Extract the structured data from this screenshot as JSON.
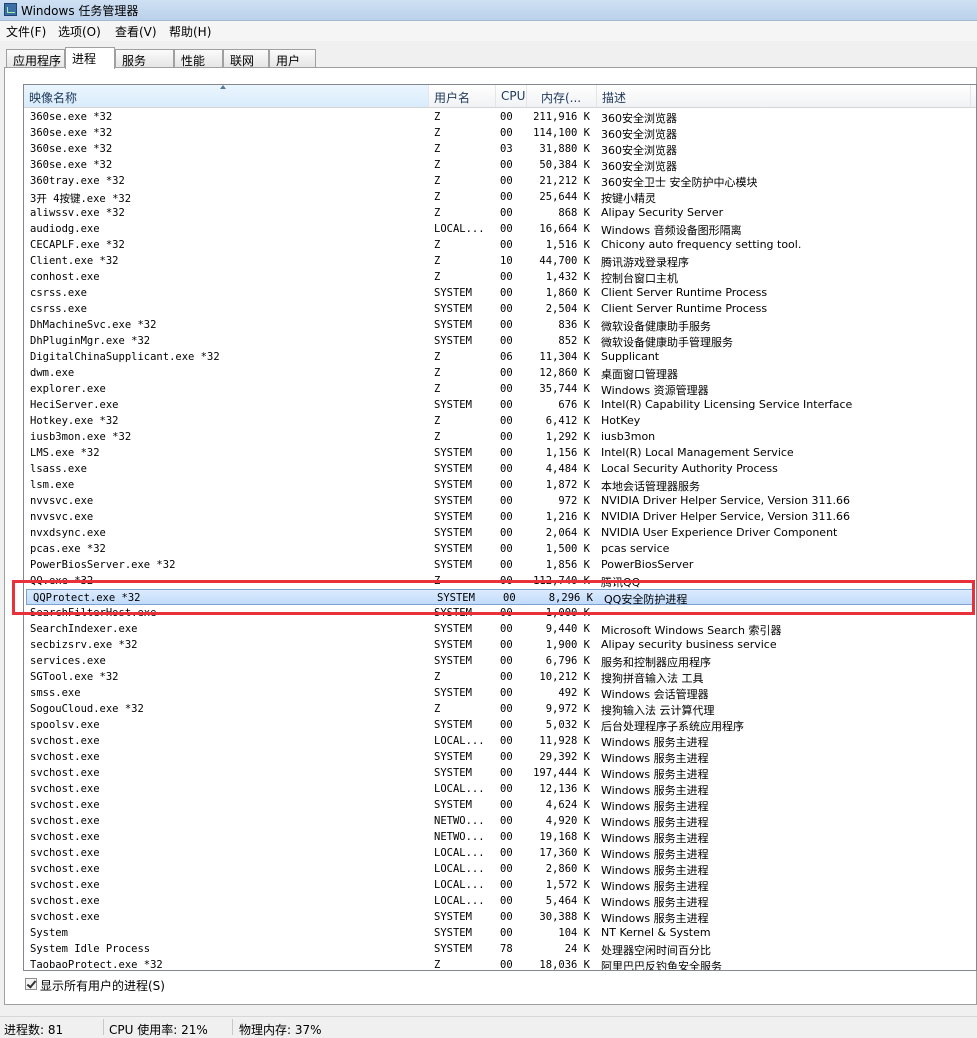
{
  "window": {
    "title": "Windows 任务管理器"
  },
  "menu": [
    "文件(F)",
    "选项(O)",
    "查看(V)",
    "帮助(H)"
  ],
  "tabs": [
    "应用程序",
    "进程",
    "服务",
    "性能",
    "联网",
    "用户"
  ],
  "active_tab": "进程",
  "columns": {
    "name": "映像名称",
    "user": "用户名",
    "cpu": "CPU",
    "mem": "内存(...",
    "desc": "描述"
  },
  "processes": [
    {
      "name": "360se.exe *32",
      "user": "Z",
      "cpu": "00",
      "mem": "211,916 K",
      "desc": "360安全浏览器"
    },
    {
      "name": "360se.exe *32",
      "user": "Z",
      "cpu": "00",
      "mem": "114,100 K",
      "desc": "360安全浏览器"
    },
    {
      "name": "360se.exe *32",
      "user": "Z",
      "cpu": "03",
      "mem": "31,880 K",
      "desc": "360安全浏览器"
    },
    {
      "name": "360se.exe *32",
      "user": "Z",
      "cpu": "00",
      "mem": "50,384 K",
      "desc": "360安全浏览器"
    },
    {
      "name": "360tray.exe *32",
      "user": "Z",
      "cpu": "00",
      "mem": "21,212 K",
      "desc": "360安全卫士 安全防护中心模块"
    },
    {
      "name": "3开 4按键.exe *32",
      "user": "Z",
      "cpu": "00",
      "mem": "25,644 K",
      "desc": "按键小精灵"
    },
    {
      "name": "aliwssv.exe *32",
      "user": "Z",
      "cpu": "00",
      "mem": "868 K",
      "desc": "Alipay Security Server"
    },
    {
      "name": "audiodg.exe",
      "user": "LOCAL...",
      "cpu": "00",
      "mem": "16,664 K",
      "desc": "Windows 音频设备图形隔离"
    },
    {
      "name": "CECAPLF.exe *32",
      "user": "Z",
      "cpu": "00",
      "mem": "1,516 K",
      "desc": "Chicony auto frequency setting tool."
    },
    {
      "name": "Client.exe *32",
      "user": "Z",
      "cpu": "10",
      "mem": "44,700 K",
      "desc": "腾讯游戏登录程序"
    },
    {
      "name": "conhost.exe",
      "user": "Z",
      "cpu": "00",
      "mem": "1,432 K",
      "desc": "控制台窗口主机"
    },
    {
      "name": "csrss.exe",
      "user": "SYSTEM",
      "cpu": "00",
      "mem": "1,860 K",
      "desc": "Client Server Runtime Process"
    },
    {
      "name": "csrss.exe",
      "user": "SYSTEM",
      "cpu": "00",
      "mem": "2,504 K",
      "desc": "Client Server Runtime Process"
    },
    {
      "name": "DhMachineSvc.exe *32",
      "user": "SYSTEM",
      "cpu": "00",
      "mem": "836 K",
      "desc": "微软设备健康助手服务"
    },
    {
      "name": "DhPluginMgr.exe *32",
      "user": "SYSTEM",
      "cpu": "00",
      "mem": "852 K",
      "desc": "微软设备健康助手管理服务"
    },
    {
      "name": "DigitalChinaSupplicant.exe *32",
      "user": "Z",
      "cpu": "06",
      "mem": "11,304 K",
      "desc": "Supplicant"
    },
    {
      "name": "dwm.exe",
      "user": "Z",
      "cpu": "00",
      "mem": "12,860 K",
      "desc": "桌面窗口管理器"
    },
    {
      "name": "explorer.exe",
      "user": "Z",
      "cpu": "00",
      "mem": "35,744 K",
      "desc": "Windows 资源管理器"
    },
    {
      "name": "HeciServer.exe",
      "user": "SYSTEM",
      "cpu": "00",
      "mem": "676 K",
      "desc": "Intel(R) Capability Licensing Service Interface"
    },
    {
      "name": "Hotkey.exe *32",
      "user": "Z",
      "cpu": "00",
      "mem": "6,412 K",
      "desc": "HotKey"
    },
    {
      "name": "iusb3mon.exe *32",
      "user": "Z",
      "cpu": "00",
      "mem": "1,292 K",
      "desc": "iusb3mon"
    },
    {
      "name": "LMS.exe *32",
      "user": "SYSTEM",
      "cpu": "00",
      "mem": "1,156 K",
      "desc": "Intel(R) Local Management Service"
    },
    {
      "name": "lsass.exe",
      "user": "SYSTEM",
      "cpu": "00",
      "mem": "4,484 K",
      "desc": "Local Security Authority Process"
    },
    {
      "name": "lsm.exe",
      "user": "SYSTEM",
      "cpu": "00",
      "mem": "1,872 K",
      "desc": "本地会话管理器服务"
    },
    {
      "name": "nvvsvc.exe",
      "user": "SYSTEM",
      "cpu": "00",
      "mem": "972 K",
      "desc": "NVIDIA Driver Helper Service, Version 311.66"
    },
    {
      "name": "nvvsvc.exe",
      "user": "SYSTEM",
      "cpu": "00",
      "mem": "1,216 K",
      "desc": "NVIDIA Driver Helper Service, Version 311.66"
    },
    {
      "name": "nvxdsync.exe",
      "user": "SYSTEM",
      "cpu": "00",
      "mem": "2,064 K",
      "desc": "NVIDIA User Experience Driver Component"
    },
    {
      "name": "pcas.exe *32",
      "user": "SYSTEM",
      "cpu": "00",
      "mem": "1,500 K",
      "desc": "pcas service"
    },
    {
      "name": "PowerBiosServer.exe *32",
      "user": "SYSTEM",
      "cpu": "00",
      "mem": "1,856 K",
      "desc": "PowerBiosServer"
    },
    {
      "name": "QQ.exe *32",
      "user": "Z",
      "cpu": "00",
      "mem": "112,740 K",
      "desc": "腾讯QQ"
    },
    {
      "name": "QQProtect.exe *32",
      "user": "SYSTEM",
      "cpu": "00",
      "mem": "8,296 K",
      "desc": "QQ安全防护进程",
      "selected": true
    },
    {
      "name": "SearchFilterHost.exe",
      "user": "SYSTEM",
      "cpu": "00",
      "mem": "1,000 K",
      "desc": ""
    },
    {
      "name": "SearchIndexer.exe",
      "user": "SYSTEM",
      "cpu": "00",
      "mem": "9,440 K",
      "desc": "Microsoft Windows Search 索引器"
    },
    {
      "name": "secbizsrv.exe *32",
      "user": "SYSTEM",
      "cpu": "00",
      "mem": "1,900 K",
      "desc": "Alipay security business service"
    },
    {
      "name": "services.exe",
      "user": "SYSTEM",
      "cpu": "00",
      "mem": "6,796 K",
      "desc": "服务和控制器应用程序"
    },
    {
      "name": "SGTool.exe *32",
      "user": "Z",
      "cpu": "00",
      "mem": "10,212 K",
      "desc": "搜狗拼音输入法 工具"
    },
    {
      "name": "smss.exe",
      "user": "SYSTEM",
      "cpu": "00",
      "mem": "492 K",
      "desc": "Windows 会话管理器"
    },
    {
      "name": "SogouCloud.exe *32",
      "user": "Z",
      "cpu": "00",
      "mem": "9,972 K",
      "desc": "搜狗输入法 云计算代理"
    },
    {
      "name": "spoolsv.exe",
      "user": "SYSTEM",
      "cpu": "00",
      "mem": "5,032 K",
      "desc": "后台处理程序子系统应用程序"
    },
    {
      "name": "svchost.exe",
      "user": "LOCAL...",
      "cpu": "00",
      "mem": "11,928 K",
      "desc": "Windows 服务主进程"
    },
    {
      "name": "svchost.exe",
      "user": "SYSTEM",
      "cpu": "00",
      "mem": "29,392 K",
      "desc": "Windows 服务主进程"
    },
    {
      "name": "svchost.exe",
      "user": "SYSTEM",
      "cpu": "00",
      "mem": "197,444 K",
      "desc": "Windows 服务主进程"
    },
    {
      "name": "svchost.exe",
      "user": "LOCAL...",
      "cpu": "00",
      "mem": "12,136 K",
      "desc": "Windows 服务主进程"
    },
    {
      "name": "svchost.exe",
      "user": "SYSTEM",
      "cpu": "00",
      "mem": "4,624 K",
      "desc": "Windows 服务主进程"
    },
    {
      "name": "svchost.exe",
      "user": "NETWO...",
      "cpu": "00",
      "mem": "4,920 K",
      "desc": "Windows 服务主进程"
    },
    {
      "name": "svchost.exe",
      "user": "NETWO...",
      "cpu": "00",
      "mem": "19,168 K",
      "desc": "Windows 服务主进程"
    },
    {
      "name": "svchost.exe",
      "user": "LOCAL...",
      "cpu": "00",
      "mem": "17,360 K",
      "desc": "Windows 服务主进程"
    },
    {
      "name": "svchost.exe",
      "user": "LOCAL...",
      "cpu": "00",
      "mem": "2,860 K",
      "desc": "Windows 服务主进程"
    },
    {
      "name": "svchost.exe",
      "user": "LOCAL...",
      "cpu": "00",
      "mem": "1,572 K",
      "desc": "Windows 服务主进程"
    },
    {
      "name": "svchost.exe",
      "user": "LOCAL...",
      "cpu": "00",
      "mem": "5,464 K",
      "desc": "Windows 服务主进程"
    },
    {
      "name": "svchost.exe",
      "user": "SYSTEM",
      "cpu": "00",
      "mem": "30,388 K",
      "desc": "Windows 服务主进程"
    },
    {
      "name": "System",
      "user": "SYSTEM",
      "cpu": "00",
      "mem": "104 K",
      "desc": "NT Kernel & System"
    },
    {
      "name": "System Idle Process",
      "user": "SYSTEM",
      "cpu": "78",
      "mem": "24 K",
      "desc": "处理器空闲时间百分比"
    },
    {
      "name": "TaobaoProtect.exe *32",
      "user": "Z",
      "cpu": "00",
      "mem": "18,036 K",
      "desc": "阿里巴巴反钓鱼安全服务"
    }
  ],
  "show_all": {
    "label": "显示所有用户的进程(S)",
    "checked": true
  },
  "status": {
    "processes": "进程数: 81",
    "cpu": "CPU 使用率: 21%",
    "memory": "物理内存: 37%"
  },
  "colors": {
    "highlight_box": "#e8313a",
    "selection": "#c1dbfc"
  }
}
